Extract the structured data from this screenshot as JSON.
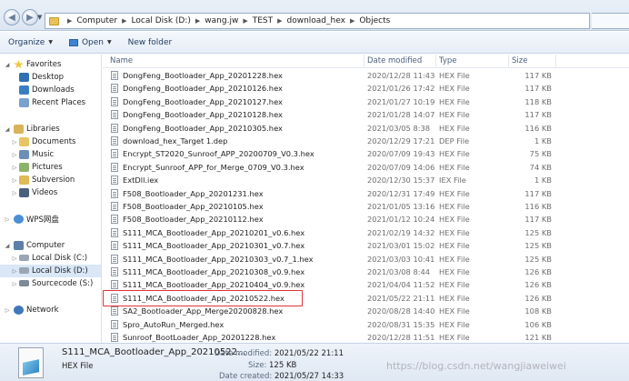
{
  "address": {
    "breadcrumbs": [
      "Computer",
      "Local Disk (D:)",
      "wang.jw",
      "TEST",
      "download_hex",
      "Objects"
    ]
  },
  "toolbar": {
    "organize_label": "Organize",
    "open_label": "Open",
    "new_folder_label": "New folder"
  },
  "nav": {
    "favorites": "Favorites",
    "desktop": "Desktop",
    "downloads": "Downloads",
    "recent_places": "Recent Places",
    "libraries": "Libraries",
    "documents": "Documents",
    "music": "Music",
    "pictures": "Pictures",
    "subversion": "Subversion",
    "videos": "Videos",
    "wps": "WPS网盘",
    "computer": "Computer",
    "local_c": "Local Disk (C:)",
    "local_d": "Local Disk (D:)",
    "sourcecode": "Sourcecode (S:)",
    "network": "Network"
  },
  "columns": {
    "name": "Name",
    "date": "Date modified",
    "type": "Type",
    "size": "Size"
  },
  "files": [
    {
      "name": "DongFeng_Bootloader_App_20201228.hex",
      "date": "2020/12/28 11:43",
      "type": "HEX File",
      "size": "117 KB"
    },
    {
      "name": "DongFeng_Bootloader_App_20210126.hex",
      "date": "2021/01/26 17:42",
      "type": "HEX File",
      "size": "117 KB"
    },
    {
      "name": "DongFeng_Bootloader_App_20210127.hex",
      "date": "2021/01/27 10:19",
      "type": "HEX File",
      "size": "118 KB"
    },
    {
      "name": "DongFeng_Bootloader_App_20210128.hex",
      "date": "2021/01/28 14:07",
      "type": "HEX File",
      "size": "117 KB"
    },
    {
      "name": "DongFeng_Bootloader_App_20210305.hex",
      "date": "2021/03/05 8:38",
      "type": "HEX File",
      "size": "116 KB"
    },
    {
      "name": "download_hex_Target 1.dep",
      "date": "2020/12/29 17:21",
      "type": "DEP File",
      "size": "1 KB"
    },
    {
      "name": "Encrypt_ST2020_Sunroof_APP_20200709_V0.3.hex",
      "date": "2020/07/09 19:43",
      "type": "HEX File",
      "size": "75 KB"
    },
    {
      "name": "Encrypt_Sunroof_APP_for_Merge_0709_V0.3.hex",
      "date": "2020/07/09 14:06",
      "type": "HEX File",
      "size": "74 KB"
    },
    {
      "name": "ExtDll.iex",
      "date": "2020/12/30 15:37",
      "type": "IEX File",
      "size": "1 KB"
    },
    {
      "name": "F508_Bootloader_App_20201231.hex",
      "date": "2020/12/31 17:49",
      "type": "HEX File",
      "size": "117 KB"
    },
    {
      "name": "F508_Bootloader_App_20210105.hex",
      "date": "2021/01/05 13:16",
      "type": "HEX File",
      "size": "116 KB"
    },
    {
      "name": "F508_Bootloader_App_20210112.hex",
      "date": "2021/01/12 10:24",
      "type": "HEX File",
      "size": "117 KB"
    },
    {
      "name": "S111_MCA_Bootloader_App_20210201_v0.6.hex",
      "date": "2021/02/19 14:32",
      "type": "HEX File",
      "size": "125 KB"
    },
    {
      "name": "S111_MCA_Bootloader_App_20210301_v0.7.hex",
      "date": "2021/03/01 15:02",
      "type": "HEX File",
      "size": "125 KB"
    },
    {
      "name": "S111_MCA_Bootloader_App_20210303_v0.7_1.hex",
      "date": "2021/03/03 10:41",
      "type": "HEX File",
      "size": "125 KB"
    },
    {
      "name": "S111_MCA_Bootloader_App_20210308_v0.9.hex",
      "date": "2021/03/08 8:44",
      "type": "HEX File",
      "size": "126 KB"
    },
    {
      "name": "S111_MCA_Bootloader_App_20210404_v0.9.hex",
      "date": "2021/04/04 11:52",
      "type": "HEX File",
      "size": "126 KB"
    },
    {
      "name": "S111_MCA_Bootloader_App_20210522.hex",
      "date": "2021/05/22 21:11",
      "type": "HEX File",
      "size": "126 KB"
    },
    {
      "name": "SA2_Bootloader_App_Merge20200828.hex",
      "date": "2020/08/28 14:40",
      "type": "HEX File",
      "size": "108 KB"
    },
    {
      "name": "Spro_AutoRun_Merged.hex",
      "date": "2020/08/31 15:35",
      "type": "HEX File",
      "size": "106 KB"
    },
    {
      "name": "Sunroof_BootLoader_App_20201228.hex",
      "date": "2020/12/28 11:51",
      "type": "HEX File",
      "size": "121 KB"
    }
  ],
  "details": {
    "filename": "S111_MCA_Bootloader_App_20210522...",
    "filetype": "HEX File",
    "date_modified_label": "Date modified:",
    "date_modified": "2021/05/22 21:11",
    "size_label": "Size:",
    "size": "125 KB",
    "date_created_label": "Date created:",
    "date_created": "2021/05/27 14:33"
  },
  "watermark": "https://blog.csdn.net/wangjiaweiwei",
  "colors": {
    "highlight": "#e0323b",
    "selected_nav": "#d9e7f7"
  }
}
